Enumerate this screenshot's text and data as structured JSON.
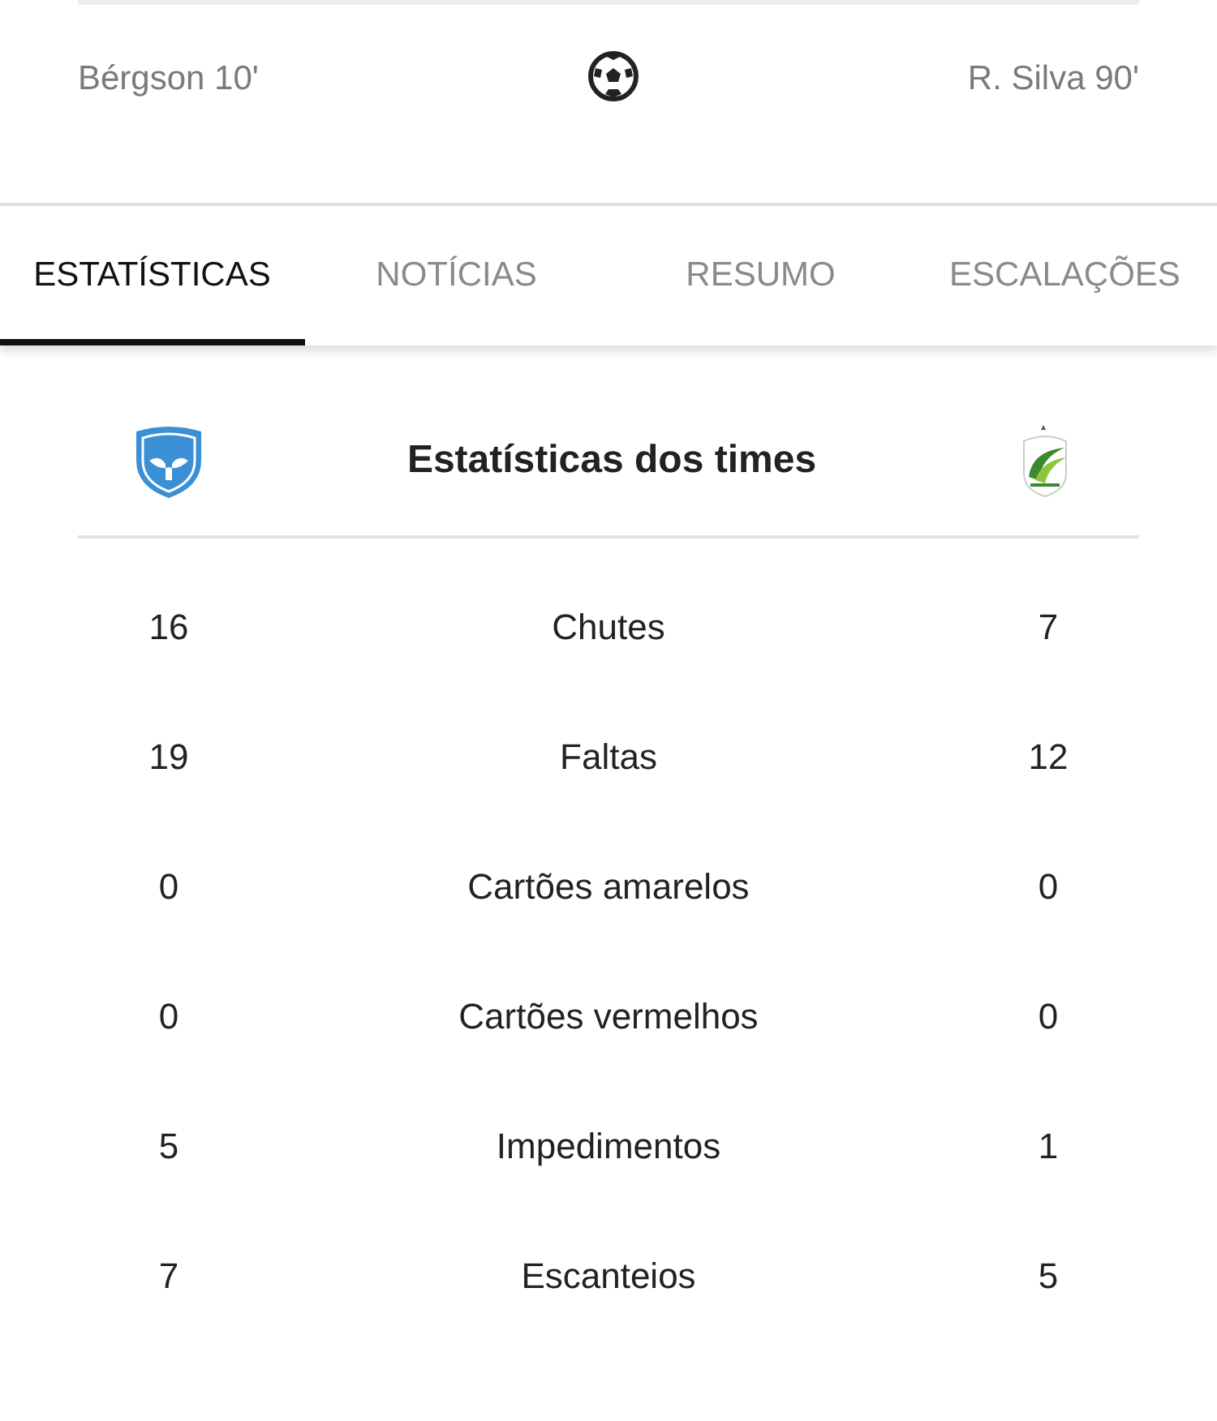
{
  "scorers": {
    "home": "Bérgson 10'",
    "away": "R. Silva 90'"
  },
  "tabs": [
    {
      "label": "ESTATÍSTICAS",
      "selected": true
    },
    {
      "label": "NOTÍCIAS",
      "selected": false
    },
    {
      "label": "RESUMO",
      "selected": false
    },
    {
      "label": "ESCALAÇÕES",
      "selected": false
    }
  ],
  "stats_title": "Estatísticas dos times",
  "stats": [
    {
      "home": "16",
      "label": "Chutes",
      "away": "7"
    },
    {
      "home": "19",
      "label": "Faltas",
      "away": "12"
    },
    {
      "home": "0",
      "label": "Cartões amarelos",
      "away": "0"
    },
    {
      "home": "0",
      "label": "Cartões vermelhos",
      "away": "0"
    },
    {
      "home": "5",
      "label": "Impedimentos",
      "away": "1"
    },
    {
      "home": "7",
      "label": "Escanteios",
      "away": "5"
    }
  ]
}
